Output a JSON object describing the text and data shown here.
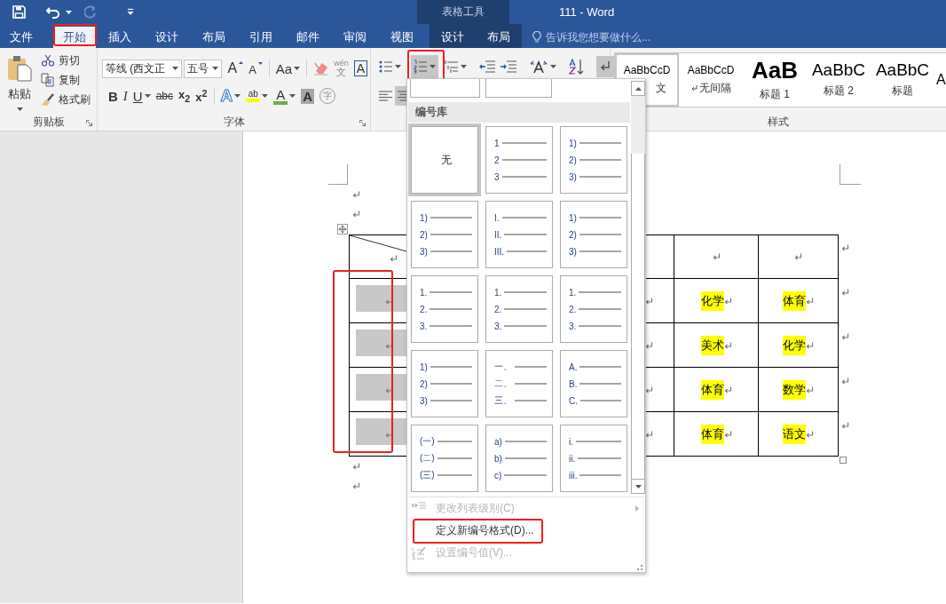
{
  "quick_access": {
    "undo_enabled": true,
    "redo_enabled": false
  },
  "window": {
    "title": "111 - Word",
    "context_group": "表格工具"
  },
  "tabs": [
    {
      "label": "文件",
      "selected": false,
      "context": false,
      "annotated": false
    },
    {
      "label": "开始",
      "selected": true,
      "context": false,
      "annotated": true
    },
    {
      "label": "插入",
      "selected": false,
      "context": false,
      "annotated": false
    },
    {
      "label": "设计",
      "selected": false,
      "context": false,
      "annotated": false
    },
    {
      "label": "布局",
      "selected": false,
      "context": false,
      "annotated": false
    },
    {
      "label": "引用",
      "selected": false,
      "context": false,
      "annotated": false
    },
    {
      "label": "邮件",
      "selected": false,
      "context": false,
      "annotated": false
    },
    {
      "label": "审阅",
      "selected": false,
      "context": false,
      "annotated": false
    },
    {
      "label": "视图",
      "selected": false,
      "context": false,
      "annotated": false
    },
    {
      "label": "设计",
      "selected": false,
      "context": true,
      "annotated": false
    },
    {
      "label": "布局",
      "selected": false,
      "context": true,
      "annotated": false
    }
  ],
  "tell_me": {
    "placeholder": "告诉我您想要做什么..."
  },
  "ribbon": {
    "clipboard": {
      "paste": "粘贴",
      "cut": "剪切",
      "copy": "复制",
      "format_painter": "格式刷",
      "label": "剪贴板"
    },
    "font": {
      "font_name": "等线 (西文正",
      "font_size": "五号",
      "label": "字体",
      "row1": [
        {
          "kind": "grow",
          "glyph": "A",
          "caret": false
        },
        {
          "kind": "shrink",
          "glyph": "A",
          "caret": false
        },
        {
          "kind": "change_case",
          "glyph": "Aa",
          "caret": true
        },
        {
          "kind": "clear",
          "caret": false
        },
        {
          "kind": "phonetic",
          "glyph": "wén",
          "sub": "文",
          "caret": false
        },
        {
          "kind": "border",
          "glyph": "A",
          "caret": false
        }
      ],
      "row2": [
        {
          "kind": "bold",
          "glyph": "B",
          "caret": false
        },
        {
          "kind": "italic",
          "glyph": "I",
          "caret": false
        },
        {
          "kind": "underline",
          "glyph": "U",
          "caret": true
        },
        {
          "kind": "strike",
          "glyph": "abc",
          "caret": false
        },
        {
          "kind": "subscript",
          "glyph": "x$_{2}$",
          "caret": false
        },
        {
          "kind": "superscript",
          "glyph": "x$^{2}$",
          "caret": false
        },
        {
          "kind": "effects",
          "glyph": "A",
          "caret": true
        },
        {
          "kind": "highlight",
          "glyph": "ab",
          "caret": true,
          "color": "#ffff00"
        },
        {
          "kind": "font_color",
          "glyph": "A",
          "caret": true,
          "color": "#70ad47"
        },
        {
          "kind": "shading",
          "glyph": "A",
          "caret": false
        },
        {
          "kind": "enclose",
          "glyph": "字",
          "caret": false
        }
      ]
    },
    "paragraph": {
      "numbering_open": true,
      "numbering_annotated": true,
      "show_marks_on": true
    },
    "styles": {
      "label": "样式",
      "items": [
        {
          "kind": "body",
          "preview": "AaBbCcD",
          "name": "文",
          "selected": true
        },
        {
          "kind": "no_spacing",
          "preview": "AaBbCcD",
          "name": "无间隔",
          "selected": false
        },
        {
          "kind": "heading1",
          "preview": "AaB",
          "name": "标题 1",
          "selected": false
        },
        {
          "kind": "heading2",
          "preview": "AaBbC",
          "name": "标题 2",
          "selected": false
        },
        {
          "kind": "title",
          "preview": "AaBbC",
          "name": "标题",
          "selected": false
        },
        {
          "kind": "partial",
          "preview": "A",
          "selected": false
        }
      ]
    }
  },
  "document": {
    "table": {
      "annotated_first_column": true,
      "rows": [
        {
          "kind": "header"
        },
        {
          "kind": "body",
          "shaded": true,
          "cells": [
            {
              "text": "化学",
              "highlighted": true
            },
            {
              "text": "体育",
              "highlighted": true
            }
          ]
        },
        {
          "kind": "body",
          "shaded": true,
          "cells": [
            {
              "text": "美术",
              "highlighted": true
            },
            {
              "text": "化学",
              "highlighted": true
            }
          ]
        },
        {
          "kind": "body",
          "shaded": true,
          "cells": [
            {
              "text": "体育",
              "highlighted": true
            },
            {
              "text": "数学",
              "highlighted": true
            }
          ]
        },
        {
          "kind": "body",
          "shaded": true,
          "cells": [
            {
              "text": "体育",
              "highlighted": true
            },
            {
              "text": "语文",
              "highlighted": true
            }
          ]
        }
      ]
    }
  },
  "numbering_menu": {
    "section": "编号库",
    "formats": [
      {
        "kind": "none",
        "label": "无",
        "selected": true
      },
      {
        "kind": "list",
        "markers": [
          "1",
          "2",
          "3"
        ],
        "selected": false
      },
      {
        "kind": "list",
        "markers": [
          "1)",
          "2)",
          "3)"
        ],
        "selected": false
      },
      {
        "kind": "list",
        "markers": [
          "1)",
          "2)",
          "3)"
        ],
        "selected": false
      },
      {
        "kind": "list",
        "markers": [
          "I.",
          "II.",
          "III."
        ],
        "selected": false
      },
      {
        "kind": "list",
        "markers": [
          "1)",
          "2)",
          "3)"
        ],
        "selected": false
      },
      {
        "kind": "list",
        "markers": [
          "1.",
          "2.",
          "3."
        ],
        "selected": false
      },
      {
        "kind": "list",
        "markers": [
          "1.",
          "2.",
          "3."
        ],
        "selected": false
      },
      {
        "kind": "list",
        "markers": [
          "1.",
          "2.",
          "3."
        ],
        "selected": false
      },
      {
        "kind": "list",
        "markers": [
          "1)",
          "2)",
          "3)"
        ],
        "selected": false
      },
      {
        "kind": "list",
        "markers": [
          "一、",
          "二、",
          "三、"
        ],
        "selected": false
      },
      {
        "kind": "list",
        "markers": [
          "A.",
          "B.",
          "C."
        ],
        "selected": false
      },
      {
        "kind": "list",
        "markers": [
          "(一)",
          "(二)",
          "(三)"
        ],
        "selected": false
      },
      {
        "kind": "list",
        "markers": [
          "a)",
          "b)",
          "c)"
        ],
        "selected": false
      },
      {
        "kind": "list",
        "markers": [
          "i.",
          "ii.",
          "iii."
        ],
        "selected": false
      }
    ],
    "items": [
      {
        "kind": "list_level",
        "label": "更改列表级别(C)",
        "disabled": true,
        "submenu": true,
        "annotated": false
      },
      {
        "kind": "define",
        "label": "定义新编号格式(D)...",
        "disabled": false,
        "submenu": false,
        "annotated": true
      },
      {
        "kind": "set_value",
        "label": "设置编号值(V)...",
        "disabled": true,
        "submenu": false,
        "annotated": false
      }
    ]
  }
}
